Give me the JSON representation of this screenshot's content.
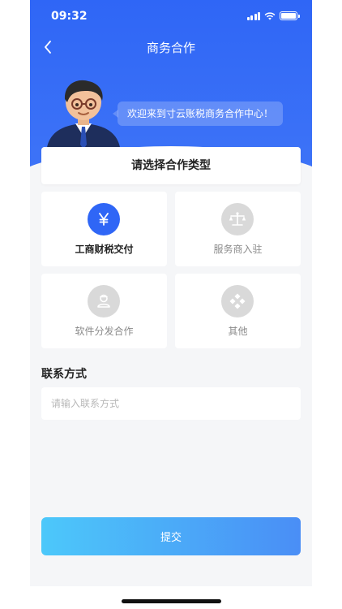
{
  "status_bar": {
    "time": "09:32"
  },
  "header": {
    "title": "商务合作"
  },
  "hero": {
    "bubble_text": "欢迎来到寸云账税商务合作中心！"
  },
  "cooperation": {
    "prompt": "请选择合作类型",
    "selected": "工商财税交付",
    "options": [
      {
        "label": "工商财税交付",
        "icon": "yuan-icon",
        "active": true
      },
      {
        "label": "服务商入驻",
        "icon": "scale-icon",
        "active": false
      },
      {
        "label": "软件分发合作",
        "icon": "person-icon",
        "active": false
      },
      {
        "label": "其他",
        "icon": "diamond-grid-icon",
        "active": false
      }
    ]
  },
  "contact": {
    "label": "联系方式",
    "value": "",
    "placeholder": "请输入联系方式"
  },
  "submit": {
    "label": "提交"
  },
  "colors": {
    "primary": "#2f66f6",
    "gradient_start": "#4cc8fa",
    "gradient_end": "#4a8ef6",
    "page_bg": "#f5f6f8",
    "inactive_icon_bg": "#d9d9d9"
  }
}
